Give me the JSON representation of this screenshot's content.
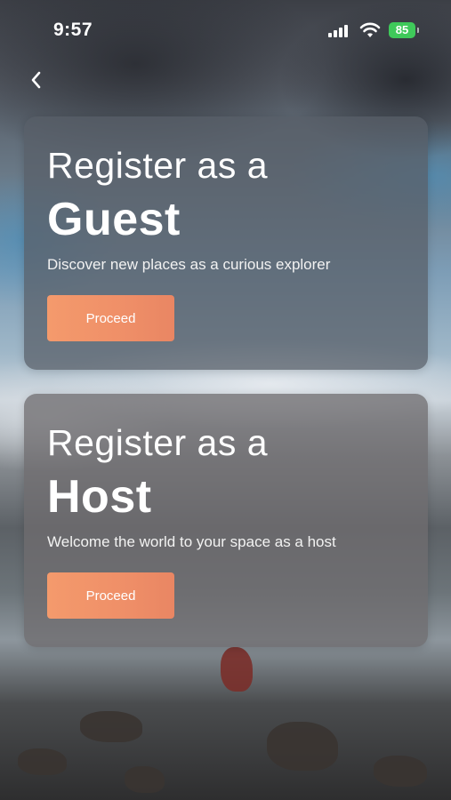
{
  "status_bar": {
    "time": "9:57",
    "battery_level": "85",
    "icons": [
      "cellular-signal-icon",
      "wifi-icon",
      "battery-charging-icon"
    ],
    "battery_color": "#3fc95a"
  },
  "nav": {
    "back_icon": "chevron-left-icon"
  },
  "cards": [
    {
      "title_line1": "Register as a",
      "title_line2": "Guest",
      "description": "Discover new places as a curious explorer",
      "button_label": "Proceed"
    },
    {
      "title_line1": "Register as a",
      "title_line2": "Host",
      "description": "Welcome the world to your space as a host",
      "button_label": "Proceed"
    }
  ],
  "colors": {
    "button_gradient_start": "#f49a6c",
    "button_gradient_end": "#e98663",
    "card_overlay": "#5c5e64"
  }
}
